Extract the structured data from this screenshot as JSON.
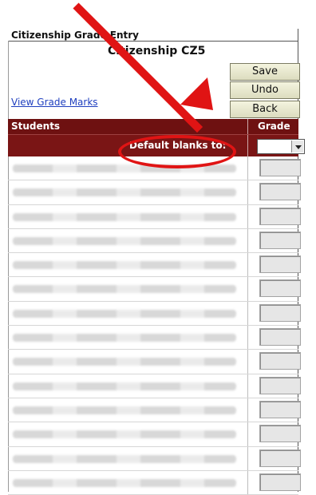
{
  "page_title": "Citizenship Grade Entry",
  "sub_title": "Citizenship CZ5",
  "buttons": {
    "save": "Save",
    "undo": "Undo",
    "back": "Back"
  },
  "link_view_grade_marks": "View Grade Marks",
  "table_headers": {
    "students": "Students",
    "grade": "Grade"
  },
  "default_blanks_label": "Default blanks to:",
  "annotation_colors": {
    "arrow": "#e01414",
    "oval": "#e01414"
  },
  "header_color": "#6e1111",
  "rows": [
    {},
    {},
    {},
    {},
    {},
    {},
    {},
    {},
    {},
    {},
    {},
    {},
    {},
    {}
  ]
}
